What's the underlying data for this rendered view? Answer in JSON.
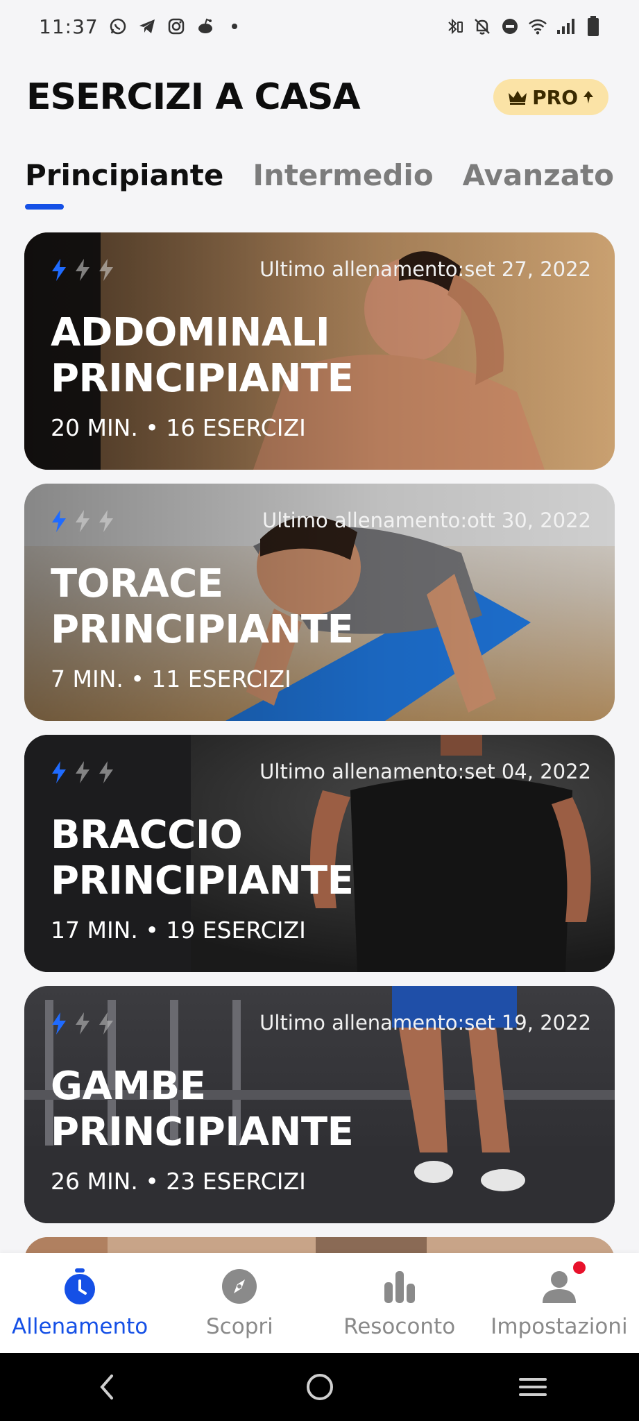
{
  "status_bar": {
    "time": "11:37"
  },
  "header": {
    "title": "ESERCIZI A CASA",
    "pro_label": "PRO"
  },
  "tabs": [
    {
      "label": "Principiante",
      "active": true
    },
    {
      "label": "Intermedio",
      "active": false
    },
    {
      "label": "Avanzato",
      "active": false
    }
  ],
  "cards": [
    {
      "title_line1": "ADDOMINALI",
      "title_line2": "PRINCIPIANTE",
      "last": "Ultimo allenamento:set 27, 2022",
      "meta": "20 MIN. • 16 ESERCIZI",
      "level": 1
    },
    {
      "title_line1": "TORACE",
      "title_line2": "PRINCIPIANTE",
      "last": "Ultimo allenamento:ott 30, 2022",
      "meta": "7 MIN. • 11 ESERCIZI",
      "level": 1
    },
    {
      "title_line1": "BRACCIO",
      "title_line2": "PRINCIPIANTE",
      "last": "Ultimo allenamento:set 04, 2022",
      "meta": "17 MIN. • 19 ESERCIZI",
      "level": 1
    },
    {
      "title_line1": "GAMBE",
      "title_line2": "PRINCIPIANTE",
      "last": "Ultimo allenamento:set 19, 2022",
      "meta": "26 MIN. • 23 ESERCIZI",
      "level": 1
    }
  ],
  "bottom_nav": [
    {
      "label": "Allenamento",
      "icon": "stopwatch-icon",
      "active": true
    },
    {
      "label": "Scopri",
      "icon": "compass-icon",
      "active": false
    },
    {
      "label": "Resoconto",
      "icon": "bar-chart-icon",
      "active": false
    },
    {
      "label": "Impostazioni",
      "icon": "user-icon",
      "active": false
    }
  ],
  "colors": {
    "accent": "#1550e6",
    "pro_badge": "#fbe3a6",
    "notification": "#e8112b"
  }
}
